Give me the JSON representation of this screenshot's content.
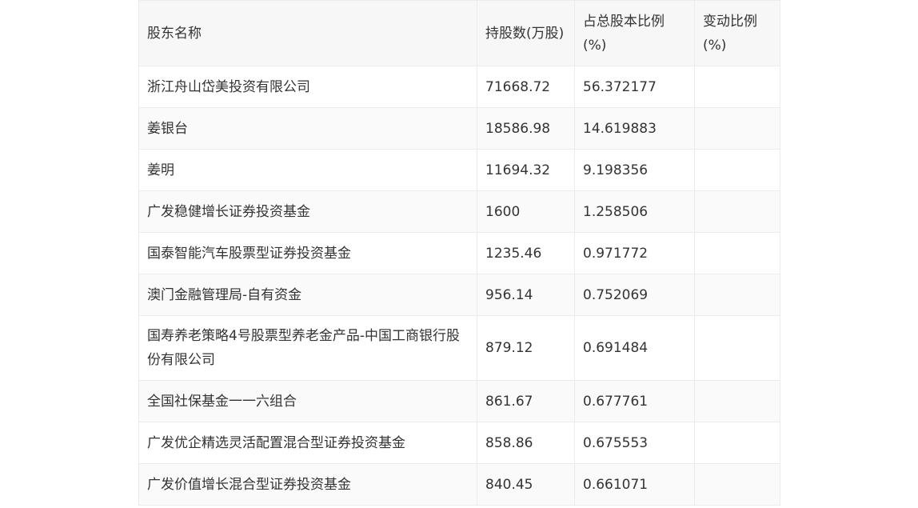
{
  "table": {
    "headers": [
      "股东名称",
      "持股数(万股)",
      "占总股本比例(%)",
      "变动比例(%)"
    ],
    "rows": [
      [
        "浙江舟山岱美投资有限公司",
        "71668.72",
        "56.372177",
        ""
      ],
      [
        "姜银台",
        "18586.98",
        "14.619883",
        ""
      ],
      [
        "姜明",
        "11694.32",
        "9.198356",
        ""
      ],
      [
        "广发稳健增长证券投资基金",
        "1600",
        "1.258506",
        ""
      ],
      [
        "国泰智能汽车股票型证券投资基金",
        "1235.46",
        "0.971772",
        ""
      ],
      [
        "澳门金融管理局-自有资金",
        "956.14",
        "0.752069",
        ""
      ],
      [
        "国寿养老策略4号股票型养老金产品-中国工商银行股份有限公司",
        "879.12",
        "0.691484",
        ""
      ],
      [
        "全国社保基金一一六组合",
        "861.67",
        "0.677761",
        ""
      ],
      [
        "广发优企精选灵活配置混合型证券投资基金",
        "858.86",
        "0.675553",
        ""
      ],
      [
        "广发价值增长混合型证券投资基金",
        "840.45",
        "0.661071",
        ""
      ]
    ]
  }
}
